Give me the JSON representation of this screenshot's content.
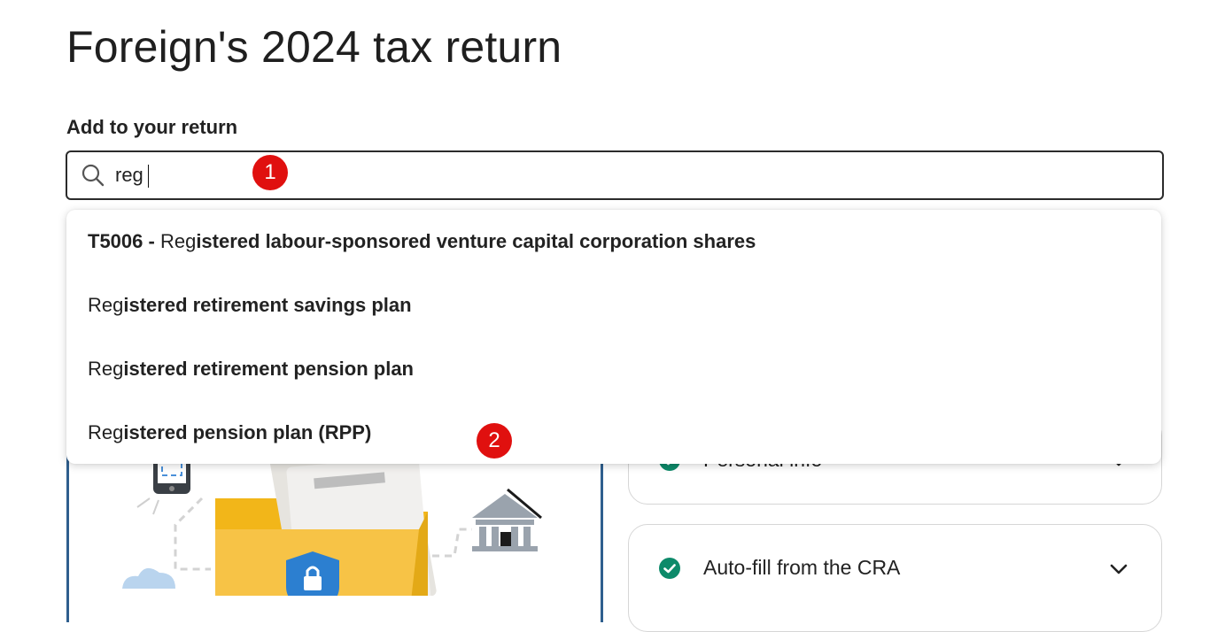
{
  "header": {
    "title": "Foreign's 2024 tax return"
  },
  "search": {
    "label": "Add to your return",
    "value": "reg",
    "icon": "search-icon"
  },
  "markers": [
    "1",
    "2"
  ],
  "suggestions": [
    {
      "code": "T5006",
      "sep": " - ",
      "match": "Reg",
      "rest": "istered labour-sponsored venture capital corporation shares"
    },
    {
      "match": "Reg",
      "rest": "istered retirement savings plan"
    },
    {
      "match": "Reg",
      "rest": "istered retirement pension plan"
    },
    {
      "match": "Reg",
      "rest": "istered pension plan (RPP)"
    }
  ],
  "accordion": [
    {
      "label": "Personal info",
      "status": "complete"
    },
    {
      "label": "Auto-fill from the CRA",
      "status": "complete"
    }
  ],
  "colors": {
    "check_green": "#0d8a6a",
    "marker_red": "#e0100f",
    "card_border_blue": "#2f5f8e",
    "folder_yellow": "#f7c346"
  }
}
